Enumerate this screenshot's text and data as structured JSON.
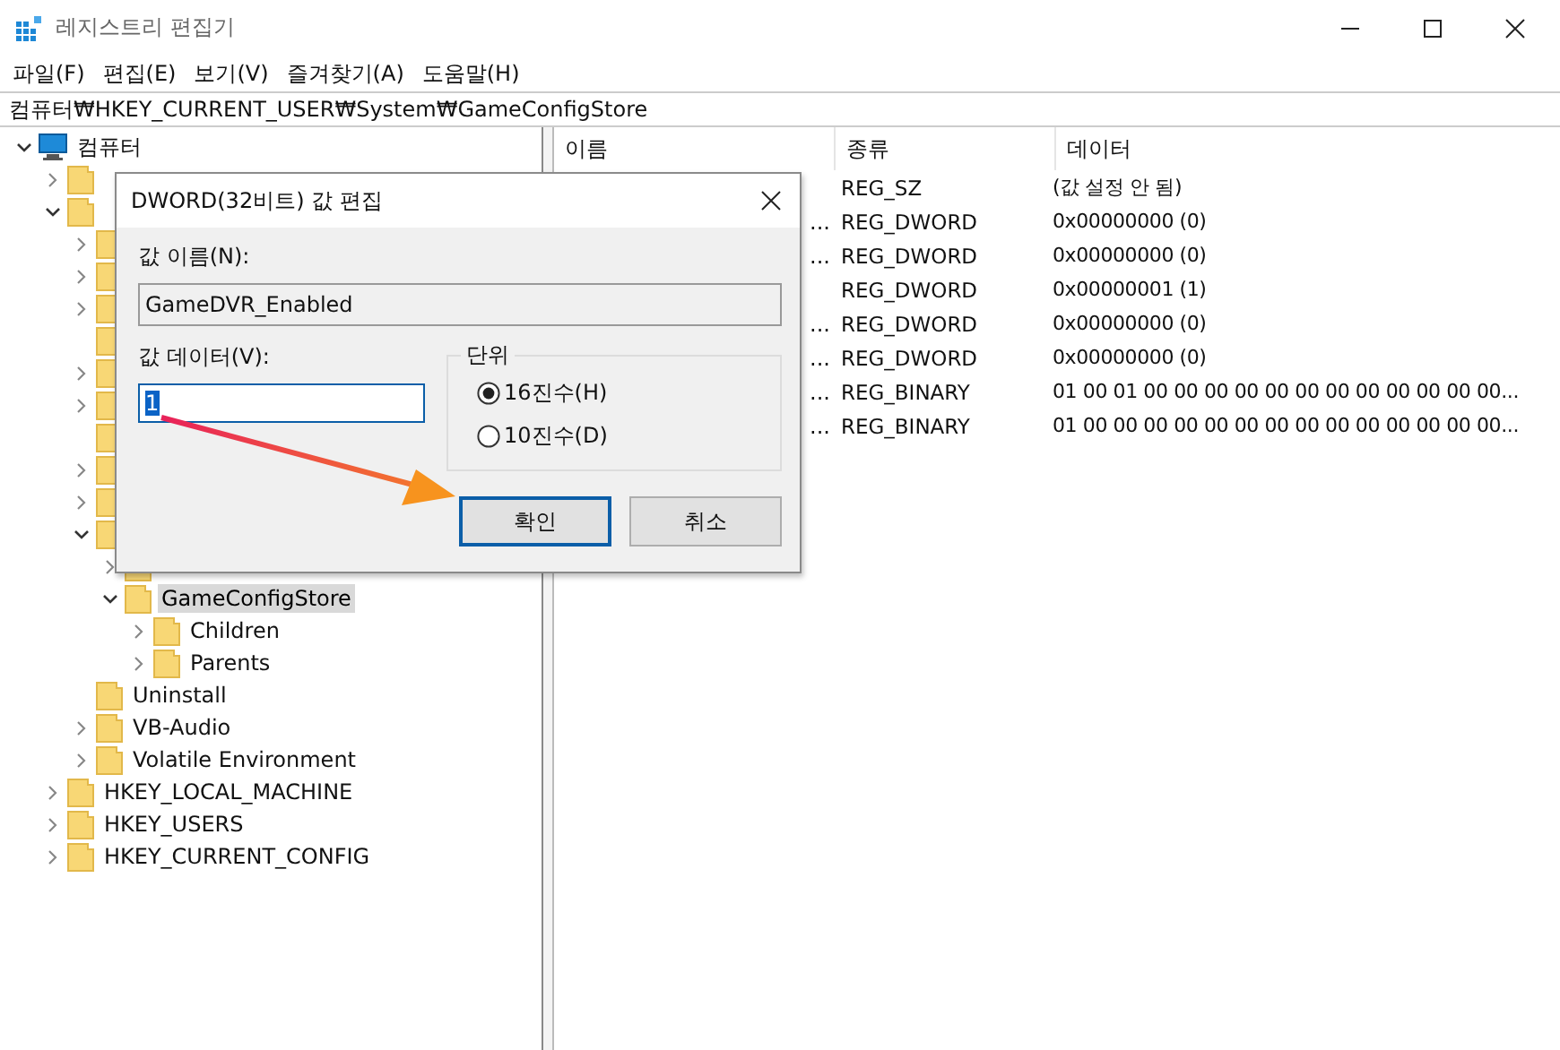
{
  "window": {
    "title": "레지스트리 편집기"
  },
  "menu": [
    "파일(F)",
    "편집(E)",
    "보기(V)",
    "즐겨찾기(A)",
    "도움말(H)"
  ],
  "address": "컴퓨터₩HKEY_CURRENT_USER₩System₩GameConfigStore",
  "tree": [
    {
      "label": "컴퓨터",
      "kind": "computer",
      "expandable": true,
      "expanded": true,
      "selected": false,
      "children": [
        {
          "kind": "folder",
          "expandable": true,
          "expanded": false
        },
        {
          "kind": "folder",
          "expandable": true,
          "expanded": true,
          "children": [
            {
              "kind": "folder",
              "expandable": true
            },
            {
              "kind": "folder",
              "expandable": true
            },
            {
              "kind": "folder",
              "expandable": true
            },
            {
              "kind": "folder",
              "expandable": false
            },
            {
              "kind": "folder",
              "expandable": true
            },
            {
              "kind": "folder",
              "expandable": true
            },
            {
              "kind": "folder",
              "expandable": false
            },
            {
              "kind": "folder",
              "expandable": true
            },
            {
              "kind": "folder",
              "expandable": true
            },
            {
              "kind": "folder",
              "expandable": true,
              "expanded": true,
              "children": [
                {
                  "kind": "folder",
                  "expandable": true
                },
                {
                  "label": "GameConfigStore",
                  "kind": "folder",
                  "expandable": true,
                  "expanded": true,
                  "selected": true,
                  "children": [
                    {
                      "label": "Children",
                      "kind": "folder",
                      "expandable": true,
                      "expanded": false,
                      "selected": false
                    },
                    {
                      "label": "Parents",
                      "kind": "folder",
                      "expandable": true,
                      "expanded": false,
                      "selected": false
                    }
                  ]
                }
              ]
            },
            {
              "label": "Uninstall",
              "kind": "folder",
              "expandable": false,
              "expanded": false,
              "selected": false
            },
            {
              "label": "VB-Audio",
              "kind": "folder",
              "expandable": true,
              "expanded": false,
              "selected": false
            },
            {
              "label": "Volatile Environment",
              "kind": "folder",
              "expandable": true,
              "expanded": false,
              "selected": false
            }
          ]
        },
        {
          "label": "HKEY_LOCAL_MACHINE",
          "kind": "folder",
          "expandable": true,
          "expanded": false,
          "selected": false
        },
        {
          "label": "HKEY_USERS",
          "kind": "folder",
          "expandable": true,
          "expanded": false,
          "selected": false
        },
        {
          "label": "HKEY_CURRENT_CONFIG",
          "kind": "folder",
          "expandable": true,
          "expanded": false,
          "selected": false
        }
      ]
    }
  ],
  "list": {
    "columns": [
      "이름",
      "종류",
      "데이터"
    ],
    "rows": [
      {
        "type": "REG_SZ",
        "data": "(값 설정 안 됨)"
      },
      {
        "name": "...",
        "type": "REG_DWORD",
        "data": "0x00000000 (0)"
      },
      {
        "name": "...",
        "type": "REG_DWORD",
        "data": "0x00000000 (0)"
      },
      {
        "type": "REG_DWORD",
        "data": "0x00000001 (1)"
      },
      {
        "name": "...",
        "type": "REG_DWORD",
        "data": "0x00000000 (0)"
      },
      {
        "name": "...",
        "type": "REG_DWORD",
        "data": "0x00000000 (0)"
      },
      {
        "name": "...",
        "type": "REG_BINARY",
        "data": "01 00 01 00 00 00 00 00 00 00 00 00 00 00 00..."
      },
      {
        "name": "...",
        "type": "REG_BINARY",
        "data": "01 00 00 00 00 00 00 00 00 00 00 00 00 00 00..."
      }
    ]
  },
  "dialog": {
    "title": "DWORD(32비트) 값 편집",
    "name_label": "값 이름(N):",
    "name_value": "GameDVR_Enabled",
    "data_label": "값 데이터(V):",
    "data_value": "1",
    "base_group": "단위",
    "bases": [
      {
        "label": "16진수(H)",
        "selected": true
      },
      {
        "label": "10진수(D)",
        "selected": false
      }
    ],
    "buttons": [
      {
        "label": "확인",
        "default": true
      },
      {
        "label": "취소",
        "default": false
      }
    ]
  }
}
